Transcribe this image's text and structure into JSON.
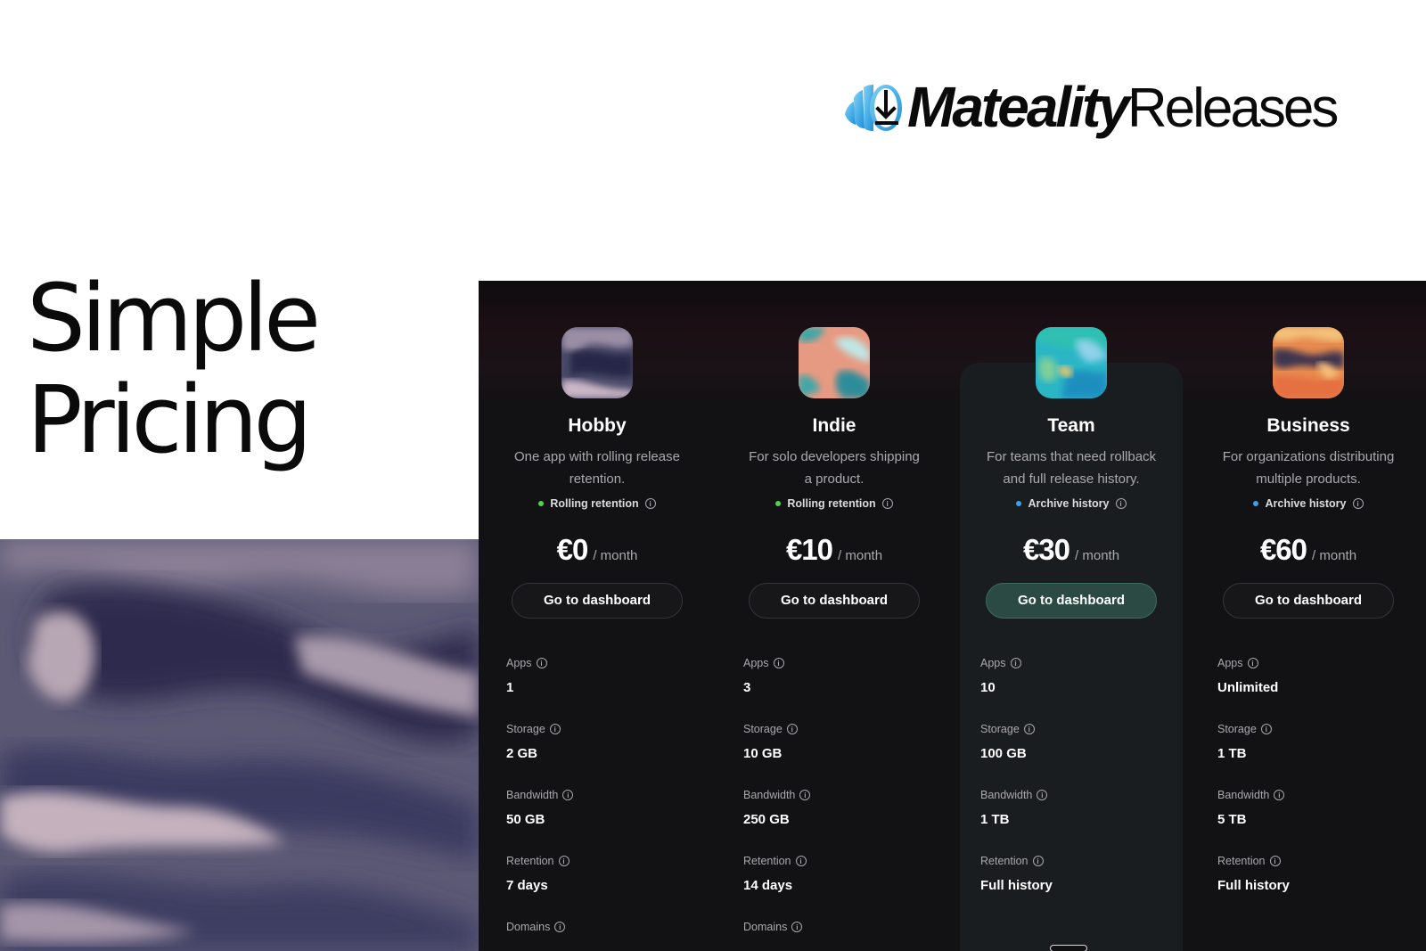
{
  "brand": {
    "name_bold": "Mateality",
    "name_light": "Releases"
  },
  "headline": {
    "line1": "Simple",
    "line2": "Pricing"
  },
  "plans": [
    {
      "name": "Hobby",
      "description": "One app with rolling release retention.",
      "badge": "Rolling retention",
      "badge_color": "#4fd34a",
      "price": "€0",
      "period": "/ month",
      "cta": "Go to dashboard",
      "features": [
        {
          "label": "Apps",
          "value": "1"
        },
        {
          "label": "Storage",
          "value": "2 GB"
        },
        {
          "label": "Bandwidth",
          "value": "50 GB"
        },
        {
          "label": "Retention",
          "value": "7 days"
        },
        {
          "label": "Domains",
          "value": ""
        }
      ]
    },
    {
      "name": "Indie",
      "description": "For solo developers shipping a product.",
      "badge": "Rolling retention",
      "badge_color": "#4fd34a",
      "price": "€10",
      "period": "/ month",
      "cta": "Go to dashboard",
      "features": [
        {
          "label": "Apps",
          "value": "3"
        },
        {
          "label": "Storage",
          "value": "10 GB"
        },
        {
          "label": "Bandwidth",
          "value": "250 GB"
        },
        {
          "label": "Retention",
          "value": "14 days"
        },
        {
          "label": "Domains",
          "value": ""
        }
      ]
    },
    {
      "name": "Team",
      "description": "For teams that need rollback and full release history.",
      "badge": "Archive history",
      "badge_color": "#3aa1ef",
      "price": "€30",
      "period": "/ month",
      "cta": "Go to dashboard",
      "featured": true,
      "features": [
        {
          "label": "Apps",
          "value": "10"
        },
        {
          "label": "Storage",
          "value": "100 GB"
        },
        {
          "label": "Bandwidth",
          "value": "1 TB"
        },
        {
          "label": "Retention",
          "value": "Full history"
        }
      ]
    },
    {
      "name": "Business",
      "description": "For organizations distributing multiple products.",
      "badge": "Archive history",
      "badge_color": "#3aa1ef",
      "price": "€60",
      "period": "/ month",
      "cta": "Go to dashboard",
      "features": [
        {
          "label": "Apps",
          "value": "Unlimited"
        },
        {
          "label": "Storage",
          "value": "1 TB"
        },
        {
          "label": "Bandwidth",
          "value": "5 TB"
        },
        {
          "label": "Retention",
          "value": "Full history"
        }
      ]
    }
  ],
  "colors": {
    "panel_bg": "#121214",
    "featured_card_bg": "#1a1d20",
    "primary_cta": "#2b4a43"
  }
}
